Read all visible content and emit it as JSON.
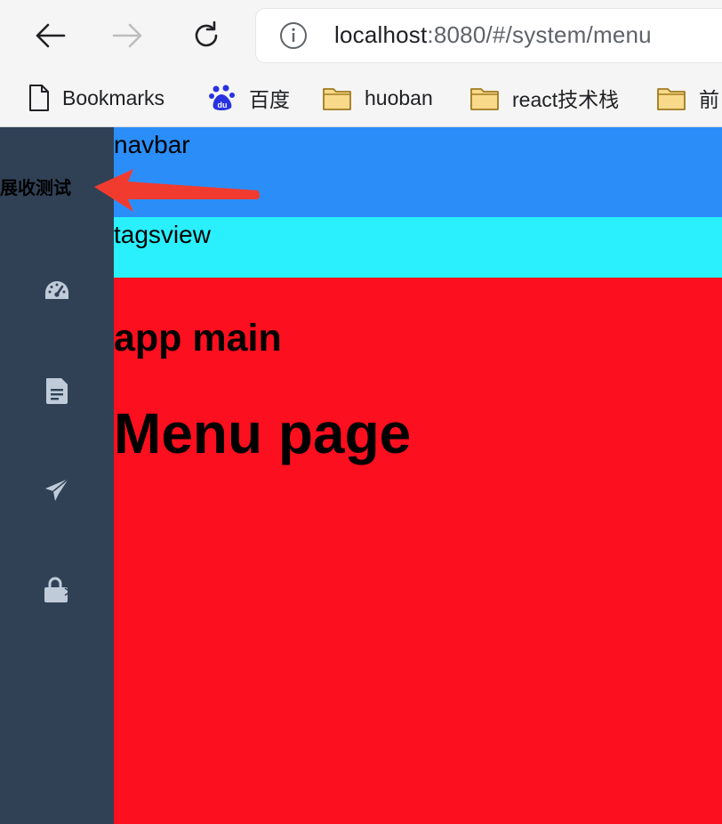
{
  "browser": {
    "url_host": "localhost",
    "url_rest": ":8080/#/system/menu"
  },
  "bookmarks": [
    {
      "label": "Bookmarks",
      "icon": "page-icon"
    },
    {
      "label": "百度",
      "icon": "baidu-icon"
    },
    {
      "label": "huoban",
      "icon": "folder-icon"
    },
    {
      "label": "react技术栈",
      "icon": "folder-icon"
    },
    {
      "label": "前",
      "icon": "folder-icon"
    }
  ],
  "sidebar": {
    "toggle_label": "展收测试",
    "icons": [
      "dashboard-icon",
      "document-icon",
      "paper-plane-icon",
      "lock-icon"
    ]
  },
  "navbar": {
    "label": "navbar"
  },
  "tagsview": {
    "label": "tagsview"
  },
  "main": {
    "heading": "app main",
    "title": "Menu page"
  },
  "colors": {
    "sidebar": "#304156",
    "navbar": "#2b8ef8",
    "tagsview": "#2af0fd",
    "main": "#fc0f1e",
    "arrow": "#f23b2f"
  }
}
